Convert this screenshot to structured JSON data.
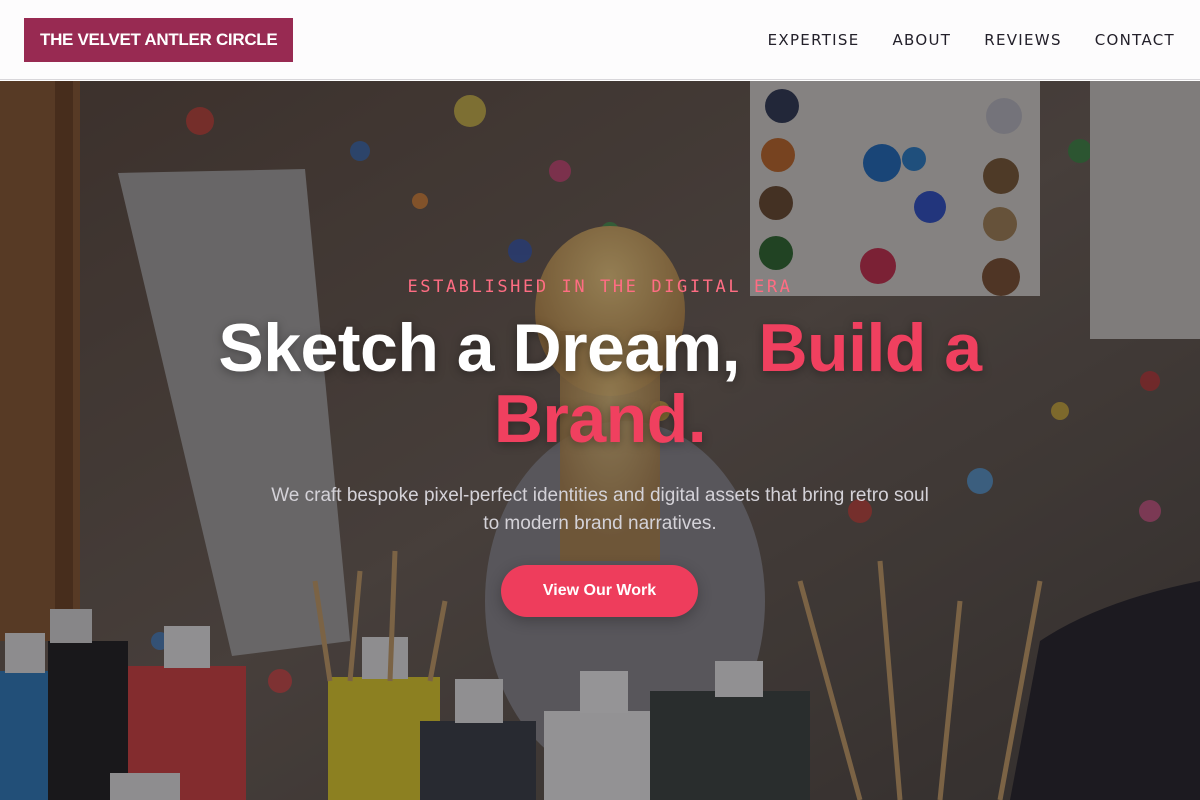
{
  "brand": {
    "name": "THE VELVET ANTLER CIRCLE"
  },
  "nav": {
    "items": [
      {
        "label": "EXPERTISE"
      },
      {
        "label": "ABOUT"
      },
      {
        "label": "REVIEWS"
      },
      {
        "label": "CONTACT"
      }
    ]
  },
  "hero": {
    "eyebrow": "ESTABLISHED IN THE DIGITAL ERA",
    "title_part1": "Sketch a Dream, ",
    "title_part2": "Build a Brand.",
    "subtitle": "We craft bespoke pixel-perfect identities and digital assets that bring retro soul to modern brand narratives.",
    "cta_label": "View Our Work",
    "background_image": "paint-studio-photo"
  },
  "colors": {
    "brand": "#982a52",
    "accent": "#f0405f",
    "eyebrow": "#ff6d83",
    "button": "#ee3d5c"
  }
}
